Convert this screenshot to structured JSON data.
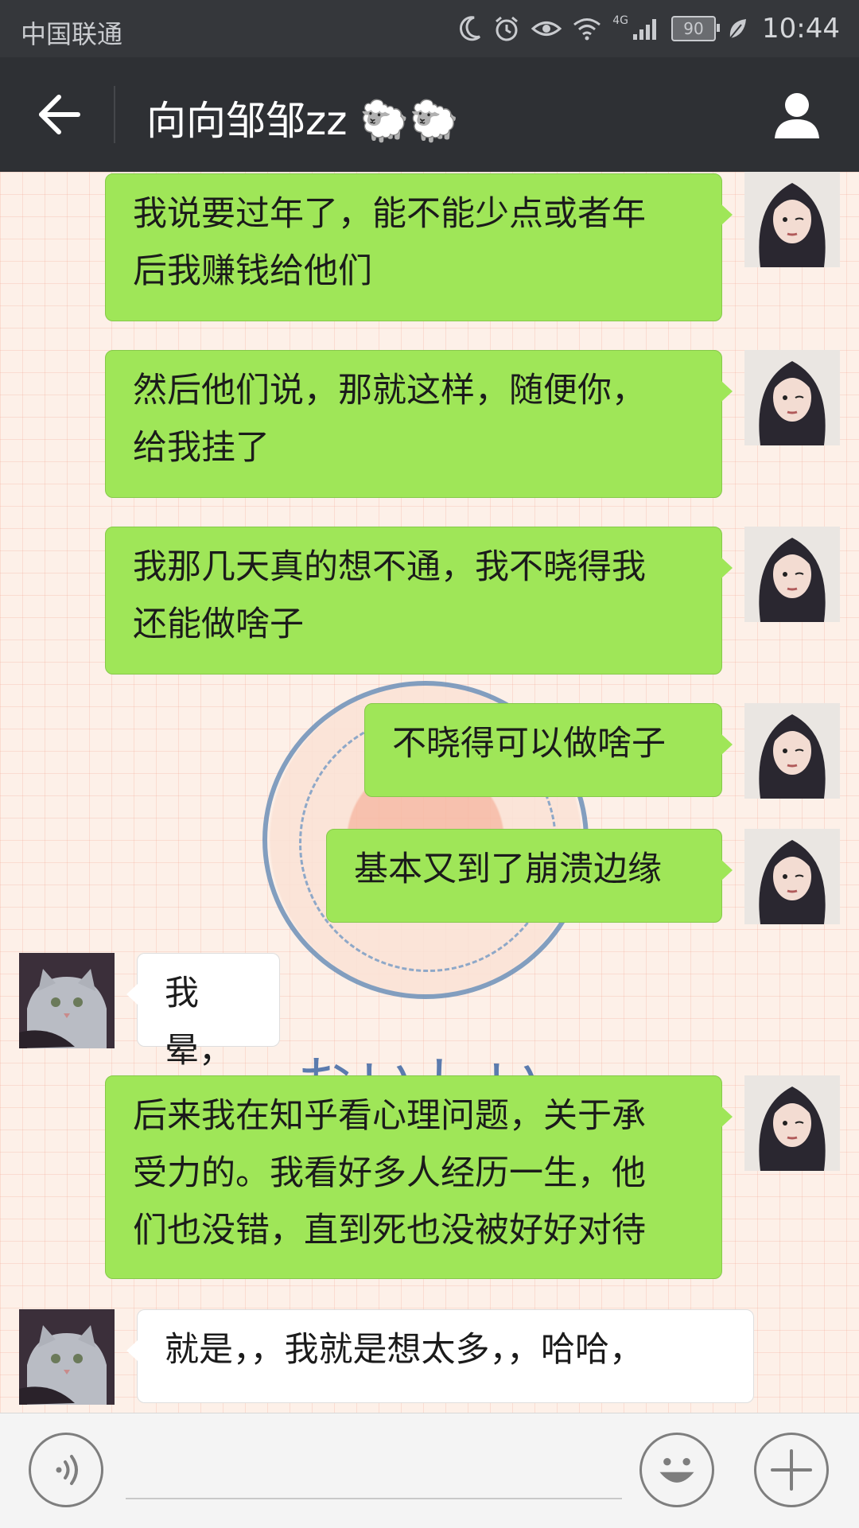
{
  "status_bar": {
    "carrier": "中国联通",
    "network": "4G",
    "battery": "90",
    "time": "10:44",
    "icons": [
      "moon-icon",
      "alarm-icon",
      "eye-icon",
      "wifi-icon",
      "signal-icon",
      "battery-icon",
      "leaf-icon"
    ]
  },
  "header": {
    "title": "向向邹邹zz 🐑🐑",
    "back_icon": "back-arrow-icon",
    "profile_icon": "person-icon"
  },
  "messages": [
    {
      "sender": "me",
      "lines": [
        "我说要过年了，能不能少点或者年",
        "后我赚钱给他们"
      ]
    },
    {
      "sender": "me",
      "lines": [
        "然后他们说，那就这样，随便你，",
        "给我挂了"
      ]
    },
    {
      "sender": "me",
      "lines": [
        "我那几天真的想不通，我不晓得我",
        "还能做啥子"
      ]
    },
    {
      "sender": "me",
      "lines": [
        "不晓得可以做啥子"
      ]
    },
    {
      "sender": "me",
      "lines": [
        "基本又到了崩溃边缘"
      ]
    },
    {
      "sender": "other",
      "lines": [
        "我晕，"
      ]
    },
    {
      "sender": "me",
      "lines": [
        "后来我在知乎看心理问题，关于承",
        "受力的。我看好多人经历一生，他",
        "们也没错，直到死也没被好好对待"
      ]
    },
    {
      "sender": "other",
      "lines": [
        "就是，，我就是想太多，，哈哈，"
      ]
    }
  ],
  "background": {
    "text": "おいしい"
  },
  "input_bar": {
    "value": "",
    "voice_icon": "voice-icon",
    "emoji_icon": "emoji-icon",
    "plus_icon": "plus-icon"
  },
  "colors": {
    "my_bubble": "#9fe658",
    "other_bubble": "#ffffff",
    "nav_bg": "#2e3034",
    "status_bg": "#35373b"
  }
}
